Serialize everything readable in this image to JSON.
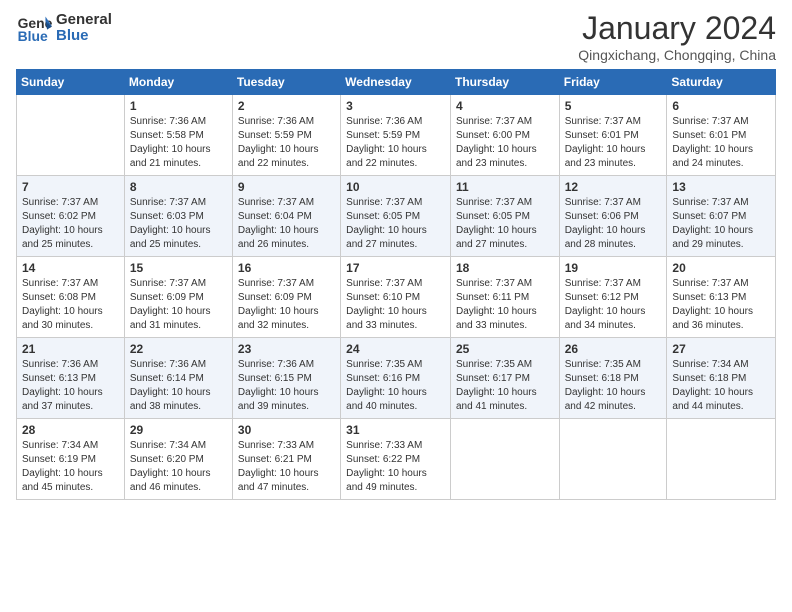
{
  "header": {
    "logo_line1": "General",
    "logo_line2": "Blue",
    "month_title": "January 2024",
    "location": "Qingxichang, Chongqing, China"
  },
  "days_of_week": [
    "Sunday",
    "Monday",
    "Tuesday",
    "Wednesday",
    "Thursday",
    "Friday",
    "Saturday"
  ],
  "weeks": [
    [
      {
        "day": "",
        "sunrise": "",
        "sunset": "",
        "daylight": ""
      },
      {
        "day": "1",
        "sunrise": "7:36 AM",
        "sunset": "5:58 PM",
        "daylight": "10 hours and 21 minutes."
      },
      {
        "day": "2",
        "sunrise": "7:36 AM",
        "sunset": "5:59 PM",
        "daylight": "10 hours and 22 minutes."
      },
      {
        "day": "3",
        "sunrise": "7:36 AM",
        "sunset": "5:59 PM",
        "daylight": "10 hours and 22 minutes."
      },
      {
        "day": "4",
        "sunrise": "7:37 AM",
        "sunset": "6:00 PM",
        "daylight": "10 hours and 23 minutes."
      },
      {
        "day": "5",
        "sunrise": "7:37 AM",
        "sunset": "6:01 PM",
        "daylight": "10 hours and 23 minutes."
      },
      {
        "day": "6",
        "sunrise": "7:37 AM",
        "sunset": "6:01 PM",
        "daylight": "10 hours and 24 minutes."
      }
    ],
    [
      {
        "day": "7",
        "sunrise": "7:37 AM",
        "sunset": "6:02 PM",
        "daylight": "10 hours and 25 minutes."
      },
      {
        "day": "8",
        "sunrise": "7:37 AM",
        "sunset": "6:03 PM",
        "daylight": "10 hours and 25 minutes."
      },
      {
        "day": "9",
        "sunrise": "7:37 AM",
        "sunset": "6:04 PM",
        "daylight": "10 hours and 26 minutes."
      },
      {
        "day": "10",
        "sunrise": "7:37 AM",
        "sunset": "6:05 PM",
        "daylight": "10 hours and 27 minutes."
      },
      {
        "day": "11",
        "sunrise": "7:37 AM",
        "sunset": "6:05 PM",
        "daylight": "10 hours and 27 minutes."
      },
      {
        "day": "12",
        "sunrise": "7:37 AM",
        "sunset": "6:06 PM",
        "daylight": "10 hours and 28 minutes."
      },
      {
        "day": "13",
        "sunrise": "7:37 AM",
        "sunset": "6:07 PM",
        "daylight": "10 hours and 29 minutes."
      }
    ],
    [
      {
        "day": "14",
        "sunrise": "7:37 AM",
        "sunset": "6:08 PM",
        "daylight": "10 hours and 30 minutes."
      },
      {
        "day": "15",
        "sunrise": "7:37 AM",
        "sunset": "6:09 PM",
        "daylight": "10 hours and 31 minutes."
      },
      {
        "day": "16",
        "sunrise": "7:37 AM",
        "sunset": "6:09 PM",
        "daylight": "10 hours and 32 minutes."
      },
      {
        "day": "17",
        "sunrise": "7:37 AM",
        "sunset": "6:10 PM",
        "daylight": "10 hours and 33 minutes."
      },
      {
        "day": "18",
        "sunrise": "7:37 AM",
        "sunset": "6:11 PM",
        "daylight": "10 hours and 33 minutes."
      },
      {
        "day": "19",
        "sunrise": "7:37 AM",
        "sunset": "6:12 PM",
        "daylight": "10 hours and 34 minutes."
      },
      {
        "day": "20",
        "sunrise": "7:37 AM",
        "sunset": "6:13 PM",
        "daylight": "10 hours and 36 minutes."
      }
    ],
    [
      {
        "day": "21",
        "sunrise": "7:36 AM",
        "sunset": "6:13 PM",
        "daylight": "10 hours and 37 minutes."
      },
      {
        "day": "22",
        "sunrise": "7:36 AM",
        "sunset": "6:14 PM",
        "daylight": "10 hours and 38 minutes."
      },
      {
        "day": "23",
        "sunrise": "7:36 AM",
        "sunset": "6:15 PM",
        "daylight": "10 hours and 39 minutes."
      },
      {
        "day": "24",
        "sunrise": "7:35 AM",
        "sunset": "6:16 PM",
        "daylight": "10 hours and 40 minutes."
      },
      {
        "day": "25",
        "sunrise": "7:35 AM",
        "sunset": "6:17 PM",
        "daylight": "10 hours and 41 minutes."
      },
      {
        "day": "26",
        "sunrise": "7:35 AM",
        "sunset": "6:18 PM",
        "daylight": "10 hours and 42 minutes."
      },
      {
        "day": "27",
        "sunrise": "7:34 AM",
        "sunset": "6:18 PM",
        "daylight": "10 hours and 44 minutes."
      }
    ],
    [
      {
        "day": "28",
        "sunrise": "7:34 AM",
        "sunset": "6:19 PM",
        "daylight": "10 hours and 45 minutes."
      },
      {
        "day": "29",
        "sunrise": "7:34 AM",
        "sunset": "6:20 PM",
        "daylight": "10 hours and 46 minutes."
      },
      {
        "day": "30",
        "sunrise": "7:33 AM",
        "sunset": "6:21 PM",
        "daylight": "10 hours and 47 minutes."
      },
      {
        "day": "31",
        "sunrise": "7:33 AM",
        "sunset": "6:22 PM",
        "daylight": "10 hours and 49 minutes."
      },
      {
        "day": "",
        "sunrise": "",
        "sunset": "",
        "daylight": ""
      },
      {
        "day": "",
        "sunrise": "",
        "sunset": "",
        "daylight": ""
      },
      {
        "day": "",
        "sunrise": "",
        "sunset": "",
        "daylight": ""
      }
    ]
  ]
}
